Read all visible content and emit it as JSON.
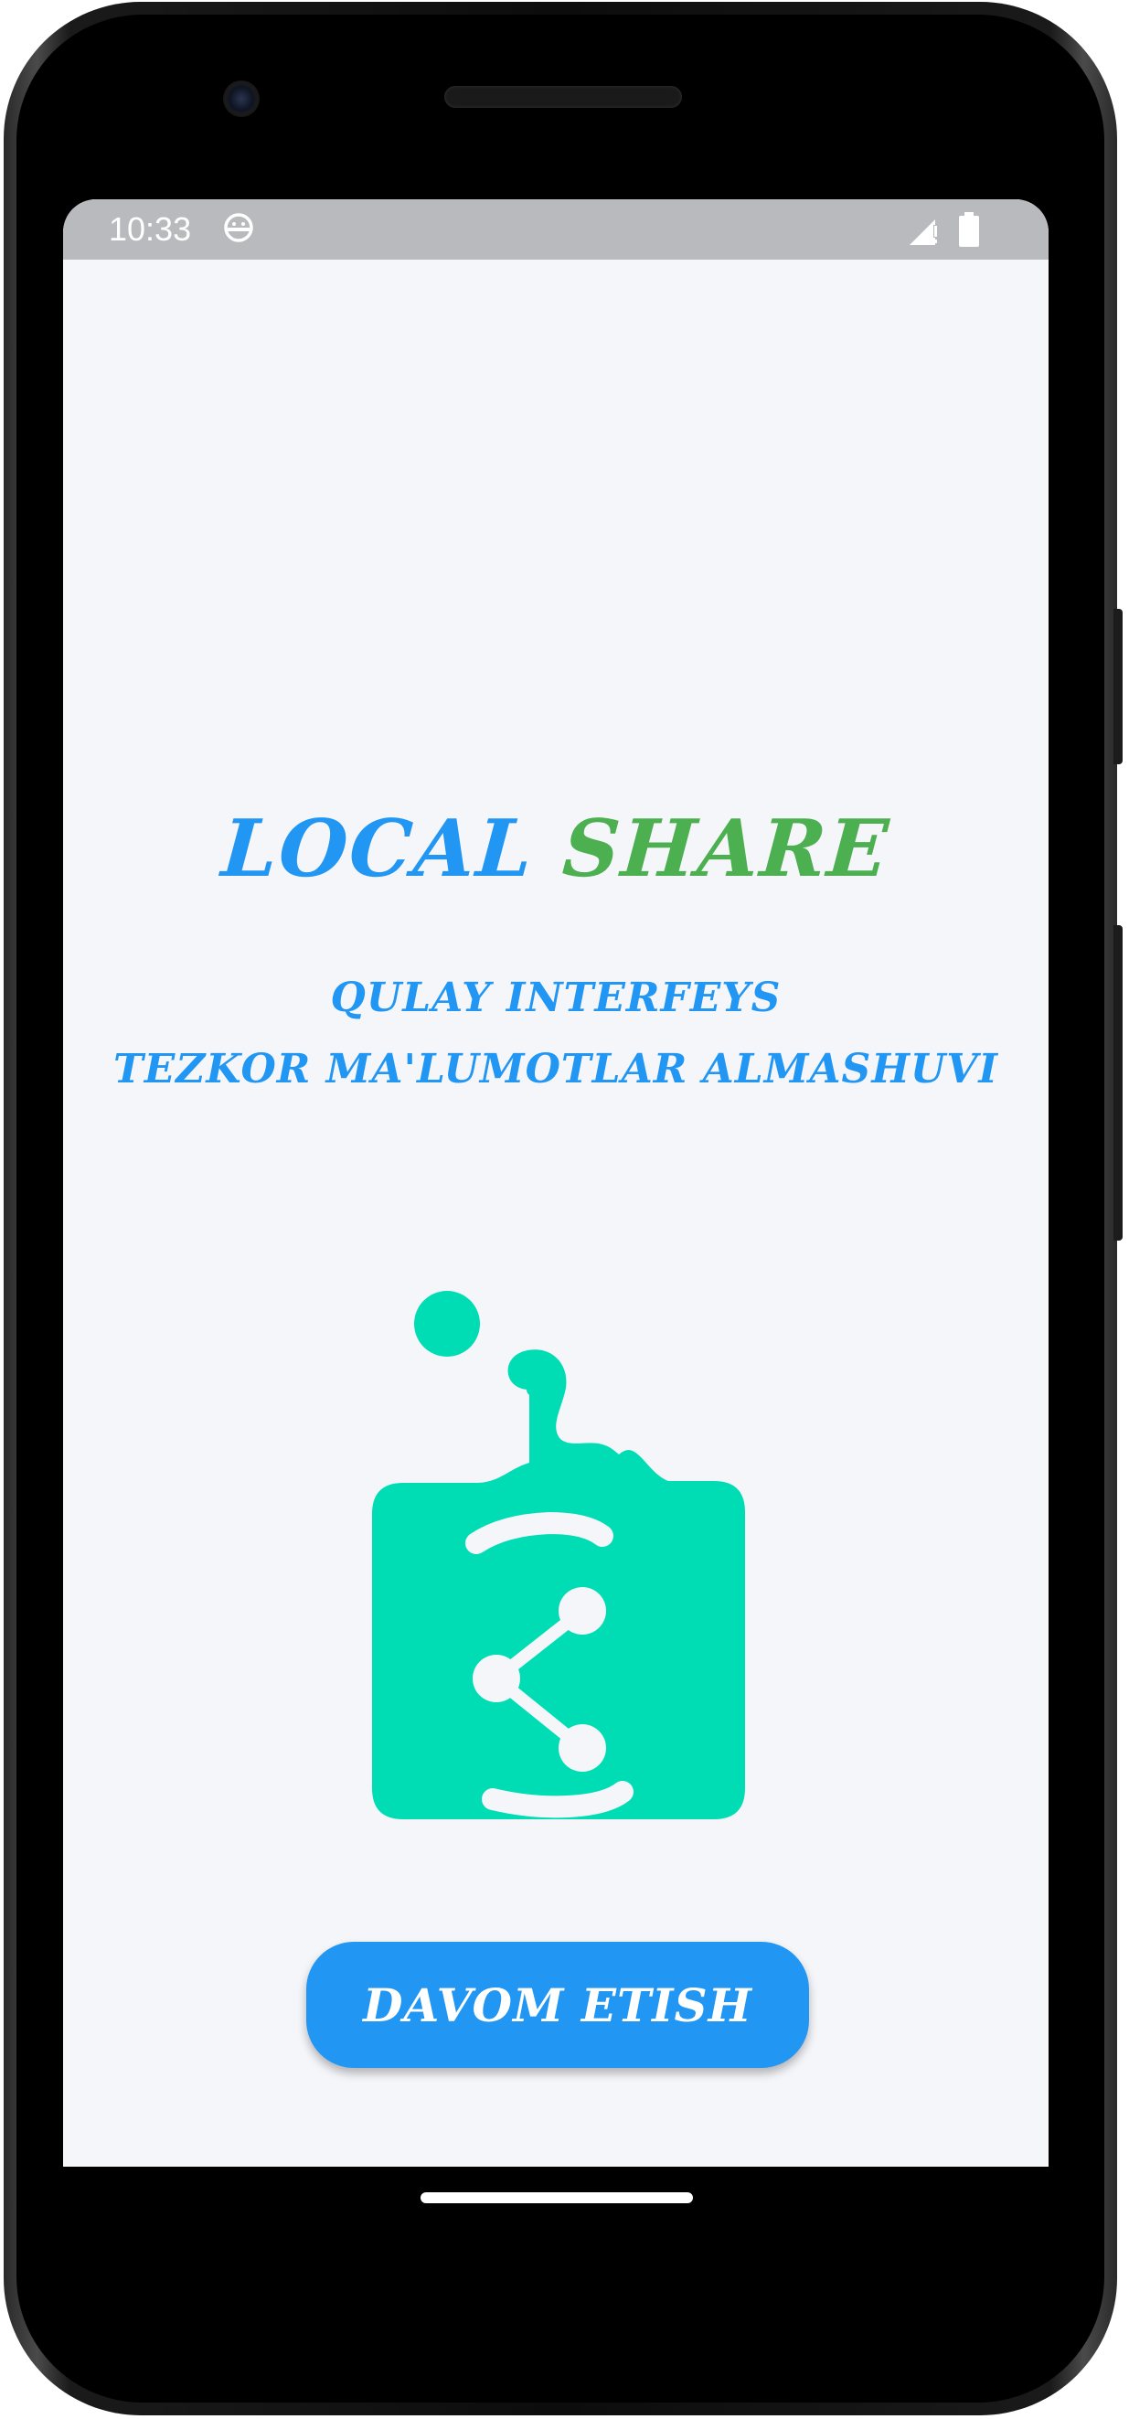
{
  "status_bar": {
    "time": "10:33",
    "icons": [
      "android-icon",
      "signal-icon",
      "battery-icon"
    ]
  },
  "app": {
    "title_part1": "LOCAL",
    "title_part2": "SHARE",
    "subtitle_line1": "QULAY INTERFEYS",
    "subtitle_line2": "TEZKOR MA'LUMOTLAR ALMASHUVI",
    "logo_icon": "share-icon",
    "continue_button_label": "DAVOM ETISH"
  },
  "colors": {
    "primary_blue": "#2196f3",
    "accent_green": "#4caf50",
    "logo_teal": "#00ddb4",
    "background": "#f5f6fa",
    "status_bar": "#b9babd"
  }
}
